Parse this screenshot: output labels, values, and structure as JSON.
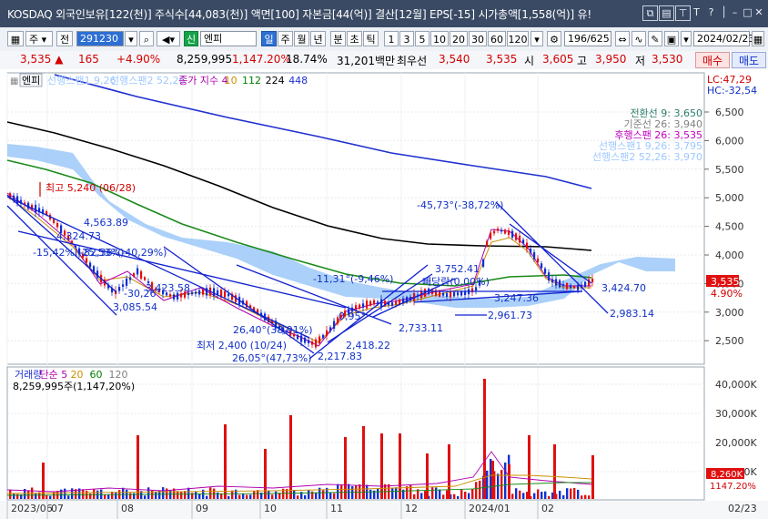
{
  "title_bar": {
    "title": "KOSDAQ 외국인보유[122(천)] 주식수[44,083(천)] 액면[100] 자본금[44(억)] 결산[12월] EPS[-15] 시가총액[1,558(억)] 유!",
    "icons": [
      "restore-icon",
      "bookmark-icon",
      "pin-icon",
      "text-size-icon",
      "help-icon",
      "separator",
      "minimize-icon",
      "maximize-icon",
      "close-icon"
    ],
    "control_glyphs": [
      "⧉",
      "▤",
      "⊤",
      "T",
      "?",
      "│",
      "–",
      "□",
      "✕"
    ]
  },
  "toolbar": {
    "stock_type": "주",
    "prev_label": "전",
    "code": "291230",
    "stock_name": "엔피",
    "new_badge": "신",
    "period_tabs": [
      "일",
      "주",
      "월",
      "년",
      "분",
      "초",
      "틱"
    ],
    "active_period": "일",
    "intervals": [
      "1",
      "3",
      "5",
      "10",
      "20",
      "30",
      "60",
      "120"
    ],
    "page_counter": "196/625",
    "date": "2024/02/23"
  },
  "quote": {
    "price": "3,535",
    "change_arrow": "▲",
    "change": "165",
    "change_pct": "+4.90%",
    "volume": "8,259,995",
    "volume_ratio": "1,147.20%",
    "turnover_pct": "18.74%",
    "amount": "31,201백만",
    "best_ask_label": "최우선",
    "best_ask": "3,540",
    "best_bid": "3,535",
    "open_label": "시",
    "open": "3,605",
    "high_label": "고",
    "high": "3,950",
    "low_label": "저",
    "low": "3,530",
    "buy_label": "매수",
    "sell_label": "매도"
  },
  "price_panel": {
    "name_tag": "엔피",
    "legend": [
      {
        "text": "선행스팬1 9,26",
        "color": "#9ec8ff"
      },
      {
        "text": "선행스팬2 52,26",
        "color": "#9ec8ff"
      },
      {
        "text": "종가 지수 4",
        "color": "#b000b0"
      },
      {
        "text": "10",
        "color": "#c89000"
      },
      {
        "text": "112",
        "color": "#008000"
      },
      {
        "text": "224",
        "color": "#000000"
      },
      {
        "text": "448",
        "color": "#2030d0"
      }
    ],
    "lc": "LC:47,29",
    "hc": "HC:-32,54",
    "ichimoku": [
      {
        "text": "전환선 9: 3,650",
        "color": "#2b7d6a"
      },
      {
        "text": "기준선 26: 3,940",
        "color": "#808080"
      },
      {
        "text": "후행스팬 26: 3,535",
        "color": "#c000c0"
      },
      {
        "text": "선행스팬1 9,26: 3,795",
        "color": "#9ec8ff"
      },
      {
        "text": "선행스팬2 52,26: 3,970",
        "color": "#9ec8ff"
      }
    ],
    "price_tag": "3,535",
    "price_tag_pct": "4.90%",
    "y_ticks": [
      "6,500",
      "6,000",
      "5,500",
      "5,000",
      "4,500",
      "4,000",
      "3,500",
      "3,000",
      "2,500"
    ],
    "annotations": [
      {
        "text": "최고 5,240 (06/28)",
        "color": "#d00000"
      },
      {
        "text": "4,563.89",
        "color": "#1030c8"
      },
      {
        "text": "4,324.73",
        "color": "#1030c8"
      },
      {
        "text": "-15,42%(-25,53%)",
        "color": "#1030c8"
      },
      {
        "text": "-82,36°(-40,29%)",
        "color": "#1030c8"
      },
      {
        "text": "-30,26°",
        "color": "#1030c8"
      },
      {
        "text": "3,423.58",
        "color": "#1030c8"
      },
      {
        "text": "3,085.54",
        "color": "#1030c8"
      },
      {
        "text": "26,40°(38,91%)",
        "color": "#1030c8"
      },
      {
        "text": "최저 2,400 (10/24)",
        "color": "#1030c8"
      },
      {
        "text": "26,05°(47,73%)",
        "color": "#1030c8"
      },
      {
        "text": "2,217.83",
        "color": "#1030c8"
      },
      {
        "text": "2,418.22",
        "color": "#1030c8"
      },
      {
        "text": "0,95°",
        "color": "#1030c8"
      },
      {
        "text": "-11,31°(-9,46%)",
        "color": "#1030c8"
      },
      {
        "text": "3,752.41",
        "color": "#1030c8"
      },
      {
        "text": "2,733.11",
        "color": "#1030c8"
      },
      {
        "text": "빼당락(0,00%)",
        "color": "#1030c8"
      },
      {
        "text": "3,247.36",
        "color": "#1030c8"
      },
      {
        "text": "2,961.73",
        "color": "#1030c8"
      },
      {
        "text": "-45,73°(-38,72%)",
        "color": "#1030c8"
      },
      {
        "text": "3,424.70",
        "color": "#1030c8"
      },
      {
        "text": "2,983.14",
        "color": "#1030c8"
      }
    ]
  },
  "volume_panel": {
    "legend": [
      {
        "text": "거래량",
        "color": "#2030d0"
      },
      {
        "text": "단순 5",
        "color": "#b000b0"
      },
      {
        "text": "20",
        "color": "#c89000"
      },
      {
        "text": "60",
        "color": "#008000"
      },
      {
        "text": "120",
        "color": "#808080"
      }
    ],
    "summary": "8,259,995주(1,147,20%)",
    "y_ticks": [
      "40,000K",
      "30,000K",
      "20,000K",
      "10,000K"
    ],
    "tag_value": "8,260K",
    "tag_pct": "1147.20%"
  },
  "x_axis": {
    "labels": [
      "2023/06",
      "07",
      "08",
      "09",
      "10",
      "11",
      "12",
      "2024/01",
      "02"
    ],
    "corner_date": "02/23"
  },
  "colors": {
    "up": "#e01010",
    "down": "#1030d0",
    "cloud": "#9cc8f8",
    "title_bg": "#3a4a64"
  }
}
